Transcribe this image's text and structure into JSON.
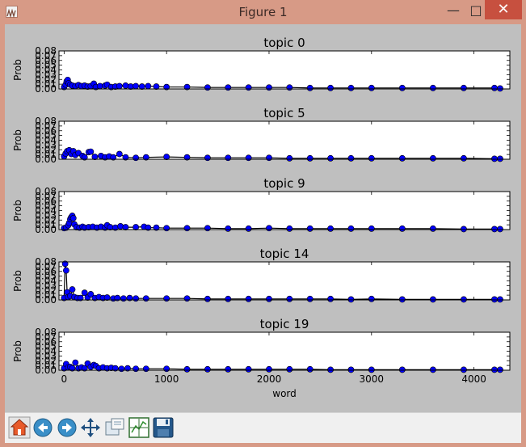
{
  "window": {
    "title": "Figure 1",
    "minimize_glyph": "—",
    "maximize_glyph": "□",
    "close_glyph": "✕"
  },
  "toolbar": {
    "buttons": [
      {
        "name": "home-button",
        "icon": "home-icon"
      },
      {
        "name": "back-button",
        "icon": "back-arrow-icon"
      },
      {
        "name": "forward-button",
        "icon": "forward-arrow-icon"
      },
      {
        "name": "pan-button",
        "icon": "pan-arrows-icon"
      },
      {
        "name": "zoom-button",
        "icon": "zoom-rect-icon"
      },
      {
        "name": "subplots-button",
        "icon": "subplots-config-icon"
      },
      {
        "name": "save-button",
        "icon": "save-disk-icon"
      }
    ]
  },
  "chart_data": {
    "type": "line",
    "marker": "circle",
    "line_color": "#000000",
    "marker_color": "#0000ff",
    "xlabel": "word",
    "ylabel": "Prob",
    "xlim": [
      -50,
      4350
    ],
    "ylim": [
      0,
      0.08
    ],
    "xticks": [
      0,
      1000,
      2000,
      3000,
      4000
    ],
    "yticks": [
      0.0,
      0.01,
      0.02,
      0.03,
      0.04,
      0.05,
      0.06,
      0.07,
      0.08
    ],
    "ytick_labels": [
      "0.00",
      "0.01",
      "0.02",
      "0.03",
      "0.04",
      "0.05",
      "0.06",
      "0.07",
      "0.08"
    ],
    "x_range": [
      0,
      4255
    ],
    "subplots": [
      {
        "title": "topic 0",
        "points": [
          [
            0,
            0.004
          ],
          [
            15,
            0.009
          ],
          [
            25,
            0.016
          ],
          [
            35,
            0.019
          ],
          [
            45,
            0.012
          ],
          [
            60,
            0.009
          ],
          [
            80,
            0.007
          ],
          [
            110,
            0.006
          ],
          [
            140,
            0.008
          ],
          [
            170,
            0.006
          ],
          [
            200,
            0.007
          ],
          [
            230,
            0.005
          ],
          [
            260,
            0.006
          ],
          [
            290,
            0.011
          ],
          [
            310,
            0.004
          ],
          [
            350,
            0.006
          ],
          [
            400,
            0.007
          ],
          [
            420,
            0.009
          ],
          [
            460,
            0.004
          ],
          [
            500,
            0.005
          ],
          [
            540,
            0.006
          ],
          [
            600,
            0.007
          ],
          [
            650,
            0.005
          ],
          [
            700,
            0.006
          ],
          [
            760,
            0.005
          ],
          [
            820,
            0.006
          ],
          [
            900,
            0.005
          ],
          [
            1000,
            0.004
          ],
          [
            1200,
            0.004
          ],
          [
            1400,
            0.003
          ],
          [
            1600,
            0.003
          ],
          [
            1800,
            0.003
          ],
          [
            2000,
            0.003
          ],
          [
            2200,
            0.003
          ],
          [
            2400,
            0.002
          ],
          [
            2600,
            0.002
          ],
          [
            2800,
            0.002
          ],
          [
            3000,
            0.002
          ],
          [
            3300,
            0.002
          ],
          [
            3600,
            0.002
          ],
          [
            3900,
            0.002
          ],
          [
            4200,
            0.002
          ],
          [
            4255,
            0.001
          ]
        ]
      },
      {
        "title": "topic 5",
        "points": [
          [
            0,
            0.006
          ],
          [
            15,
            0.012
          ],
          [
            30,
            0.017
          ],
          [
            50,
            0.019
          ],
          [
            70,
            0.011
          ],
          [
            90,
            0.017
          ],
          [
            110,
            0.009
          ],
          [
            140,
            0.013
          ],
          [
            180,
            0.007
          ],
          [
            200,
            0.004
          ],
          [
            240,
            0.015
          ],
          [
            260,
            0.016
          ],
          [
            300,
            0.005
          ],
          [
            360,
            0.007
          ],
          [
            400,
            0.004
          ],
          [
            440,
            0.006
          ],
          [
            480,
            0.004
          ],
          [
            540,
            0.011
          ],
          [
            600,
            0.004
          ],
          [
            700,
            0.003
          ],
          [
            800,
            0.004
          ],
          [
            1000,
            0.005
          ],
          [
            1200,
            0.004
          ],
          [
            1400,
            0.003
          ],
          [
            1600,
            0.003
          ],
          [
            1800,
            0.003
          ],
          [
            2000,
            0.003
          ],
          [
            2200,
            0.002
          ],
          [
            2400,
            0.002
          ],
          [
            2600,
            0.002
          ],
          [
            2800,
            0.002
          ],
          [
            3000,
            0.002
          ],
          [
            3300,
            0.002
          ],
          [
            3600,
            0.002
          ],
          [
            3900,
            0.002
          ],
          [
            4200,
            0.001
          ],
          [
            4255,
            0.001
          ]
        ]
      },
      {
        "title": "topic 9",
        "points": [
          [
            0,
            0.003
          ],
          [
            20,
            0.004
          ],
          [
            40,
            0.009
          ],
          [
            50,
            0.014
          ],
          [
            60,
            0.022
          ],
          [
            70,
            0.026
          ],
          [
            80,
            0.029
          ],
          [
            90,
            0.024
          ],
          [
            100,
            0.011
          ],
          [
            120,
            0.005
          ],
          [
            150,
            0.004
          ],
          [
            180,
            0.006
          ],
          [
            200,
            0.004
          ],
          [
            240,
            0.005
          ],
          [
            280,
            0.006
          ],
          [
            320,
            0.004
          ],
          [
            360,
            0.006
          ],
          [
            400,
            0.004
          ],
          [
            420,
            0.009
          ],
          [
            450,
            0.005
          ],
          [
            500,
            0.004
          ],
          [
            550,
            0.007
          ],
          [
            600,
            0.005
          ],
          [
            700,
            0.005
          ],
          [
            780,
            0.006
          ],
          [
            820,
            0.004
          ],
          [
            900,
            0.004
          ],
          [
            1000,
            0.003
          ],
          [
            1200,
            0.003
          ],
          [
            1400,
            0.003
          ],
          [
            1600,
            0.002
          ],
          [
            1800,
            0.002
          ],
          [
            2000,
            0.003
          ],
          [
            2200,
            0.002
          ],
          [
            2400,
            0.002
          ],
          [
            2600,
            0.002
          ],
          [
            2800,
            0.002
          ],
          [
            3000,
            0.002
          ],
          [
            3300,
            0.002
          ],
          [
            3600,
            0.002
          ],
          [
            3900,
            0.001
          ],
          [
            4200,
            0.001
          ],
          [
            4255,
            0.001
          ]
        ]
      },
      {
        "title": "topic 14",
        "points": [
          [
            0,
            0.004
          ],
          [
            10,
            0.076
          ],
          [
            20,
            0.062
          ],
          [
            30,
            0.016
          ],
          [
            40,
            0.006
          ],
          [
            60,
            0.008
          ],
          [
            80,
            0.022
          ],
          [
            100,
            0.006
          ],
          [
            130,
            0.004
          ],
          [
            160,
            0.004
          ],
          [
            200,
            0.015
          ],
          [
            230,
            0.005
          ],
          [
            260,
            0.012
          ],
          [
            300,
            0.004
          ],
          [
            340,
            0.006
          ],
          [
            380,
            0.004
          ],
          [
            420,
            0.005
          ],
          [
            480,
            0.003
          ],
          [
            520,
            0.004
          ],
          [
            580,
            0.003
          ],
          [
            640,
            0.004
          ],
          [
            700,
            0.003
          ],
          [
            800,
            0.003
          ],
          [
            1000,
            0.003
          ],
          [
            1200,
            0.003
          ],
          [
            1400,
            0.002
          ],
          [
            1600,
            0.002
          ],
          [
            1800,
            0.002
          ],
          [
            2000,
            0.002
          ],
          [
            2200,
            0.002
          ],
          [
            2400,
            0.002
          ],
          [
            2600,
            0.002
          ],
          [
            2800,
            0.001
          ],
          [
            3000,
            0.002
          ],
          [
            3300,
            0.001
          ],
          [
            3600,
            0.001
          ],
          [
            3900,
            0.001
          ],
          [
            4200,
            0.001
          ],
          [
            4255,
            0.001
          ]
        ]
      },
      {
        "title": "topic 19",
        "points": [
          [
            0,
            0.004
          ],
          [
            20,
            0.013
          ],
          [
            40,
            0.006
          ],
          [
            60,
            0.007
          ],
          [
            80,
            0.004
          ],
          [
            110,
            0.016
          ],
          [
            140,
            0.004
          ],
          [
            170,
            0.006
          ],
          [
            200,
            0.004
          ],
          [
            230,
            0.014
          ],
          [
            260,
            0.007
          ],
          [
            290,
            0.011
          ],
          [
            310,
            0.009
          ],
          [
            340,
            0.004
          ],
          [
            380,
            0.006
          ],
          [
            420,
            0.004
          ],
          [
            460,
            0.005
          ],
          [
            500,
            0.004
          ],
          [
            560,
            0.003
          ],
          [
            620,
            0.004
          ],
          [
            700,
            0.003
          ],
          [
            800,
            0.003
          ],
          [
            1000,
            0.003
          ],
          [
            1200,
            0.002
          ],
          [
            1400,
            0.002
          ],
          [
            1600,
            0.002
          ],
          [
            1800,
            0.002
          ],
          [
            2000,
            0.002
          ],
          [
            2200,
            0.002
          ],
          [
            2400,
            0.002
          ],
          [
            2600,
            0.001
          ],
          [
            2800,
            0.001
          ],
          [
            3000,
            0.001
          ],
          [
            3300,
            0.001
          ],
          [
            3600,
            0.001
          ],
          [
            3900,
            0.001
          ],
          [
            4200,
            0.001
          ],
          [
            4255,
            0.001
          ]
        ]
      }
    ]
  }
}
